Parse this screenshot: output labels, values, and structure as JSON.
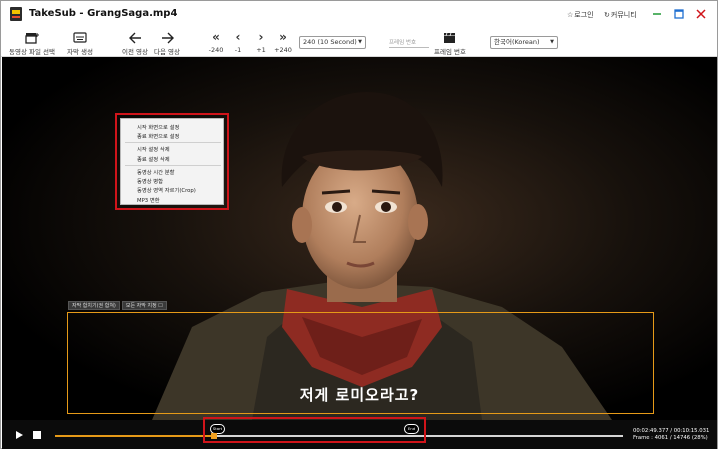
{
  "window": {
    "app_name": "TakeSub",
    "separator": " - ",
    "file_name": "GrangSaga.mp4",
    "login_label": "로그인",
    "community_label": "커뮤니티",
    "logo_icon": "app-logo-icon",
    "accent_colors": {
      "minimize": "#2ea043",
      "maximize": "#1f6fd1",
      "close": "#d0141a"
    }
  },
  "toolbar": {
    "open_video_label": "동영상 파일 선택",
    "create_subtitle_label": "자막 생성",
    "prev_video_label": "이전 영상",
    "next_video_label": "다음 영상",
    "step_buttons": [
      {
        "icon": "«",
        "label": "-240"
      },
      {
        "icon": "‹",
        "label": "-1"
      },
      {
        "icon": "›",
        "label": "+1"
      },
      {
        "icon": "»",
        "label": "+240"
      }
    ],
    "step_select_value": "240 (10 Second)",
    "frame_number_placeholder": "프레임 번호",
    "frame_number_label": "프레임 번호",
    "language_select_value": "한국어(Korean)"
  },
  "context_menu": {
    "items": [
      "시작 화면으로 설정",
      "종료 화면으로 설정",
      "시작 설정 삭제",
      "종료 설정 삭제",
      "동영상 시간 분할",
      "동영상 병합",
      "동영상 영역 자르기(Crop)",
      "MP3 변환"
    ]
  },
  "subtitle_area": {
    "chip_1": "자막 합치기(권 합쳐)",
    "chip_2": "모든 자막 지정",
    "text": "저게 로미오라고?"
  },
  "player": {
    "start_marker": "Start",
    "end_marker": "End",
    "progress_fraction": 0.28,
    "time_text": "00:02:49.377 / 00:10:15.031",
    "frame_text": "Frame : 4061 / 14746 (28%)",
    "accent_color": "#e69a18"
  }
}
